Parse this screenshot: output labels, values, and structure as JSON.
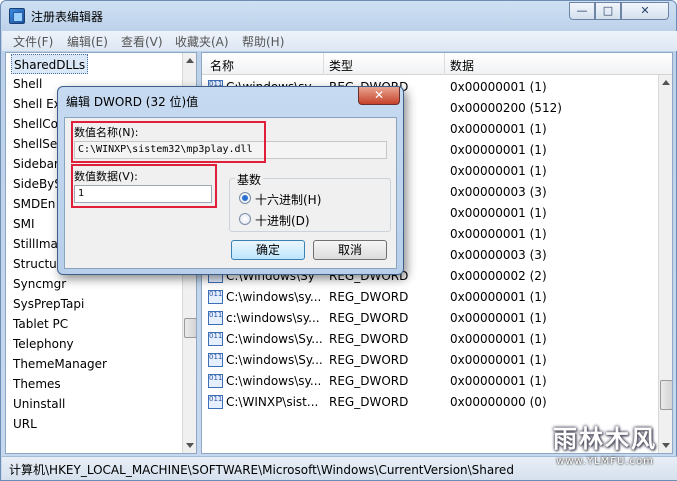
{
  "window": {
    "title": "注册表编辑器",
    "controls": {
      "minimize": "—",
      "maximize": "□",
      "close": "✕"
    }
  },
  "menu": [
    "文件(F)",
    "编辑(E)",
    "查看(V)",
    "收藏夹(A)",
    "帮助(H)"
  ],
  "tree": {
    "items": [
      "SharedDLLs",
      "Shell",
      "Shell Ex",
      "ShellCo",
      "ShellSer",
      "Sidebar",
      "SideBySi",
      "SMDEn",
      "SMI",
      "StillImag",
      "Structur",
      "Syncmgr",
      "SysPrepTapi",
      "Tablet PC",
      "Telephony",
      "ThemeManager",
      "Themes",
      "Uninstall",
      "URL"
    ]
  },
  "list": {
    "headers": [
      "名称",
      "类型",
      "数据"
    ],
    "rows": [
      {
        "name": "C:\\windows\\sy",
        "type": "REG_DWORD",
        "data": "0x00000001 (1)"
      },
      {
        "name": "",
        "type": "",
        "data": "0x00000200 (512)"
      },
      {
        "name": "",
        "type": "",
        "data": "0x00000001 (1)"
      },
      {
        "name": "",
        "type": "",
        "data": "0x00000001 (1)"
      },
      {
        "name": "",
        "type": "",
        "data": "0x00000001 (1)"
      },
      {
        "name": "",
        "type": "",
        "data": "0x00000003 (3)"
      },
      {
        "name": "",
        "type": "",
        "data": "0x00000001 (1)"
      },
      {
        "name": "",
        "type": "",
        "data": "0x00000001 (1)"
      },
      {
        "name": "",
        "type": "",
        "data": "0x00000003 (3)"
      },
      {
        "name": "C:\\Windows\\Sy",
        "type": "REG_DWORD",
        "data": "0x00000002 (2)"
      },
      {
        "name": "C:\\windows\\sy...",
        "type": "REG_DWORD",
        "data": "0x00000001 (1)"
      },
      {
        "name": "c:\\windows\\sy...",
        "type": "REG_DWORD",
        "data": "0x00000001 (1)"
      },
      {
        "name": "C:\\windows\\Sy...",
        "type": "REG_DWORD",
        "data": "0x00000001 (1)"
      },
      {
        "name": "C:\\windows\\Sy...",
        "type": "REG_DWORD",
        "data": "0x00000001 (1)"
      },
      {
        "name": "C:\\windows\\sy...",
        "type": "REG_DWORD",
        "data": "0x00000001 (1)"
      },
      {
        "name": "C:\\WINXP\\sist...",
        "type": "REG_DWORD",
        "data": "0x00000000 (0)"
      }
    ]
  },
  "status": "计算机\\HKEY_LOCAL_MACHINE\\SOFTWARE\\Microsoft\\Windows\\CurrentVersion\\Shared",
  "watermark": {
    "logo": "雨林木风",
    "url": "www.YLMFU.com"
  },
  "dialog": {
    "title": "编辑 DWORD (32 位)值",
    "close": "✕",
    "name_label": "数值名称(N):",
    "name_value": "C:\\WINXP\\sistem32\\mp3play.dll",
    "data_label": "数值数据(V):",
    "data_value": "1",
    "base_label": "基数",
    "hex_label": "十六进制(H)",
    "dec_label": "十进制(D)",
    "base_selected": "hex",
    "ok": "确定",
    "cancel": "取消",
    "highlight_color": "#e0203a"
  }
}
